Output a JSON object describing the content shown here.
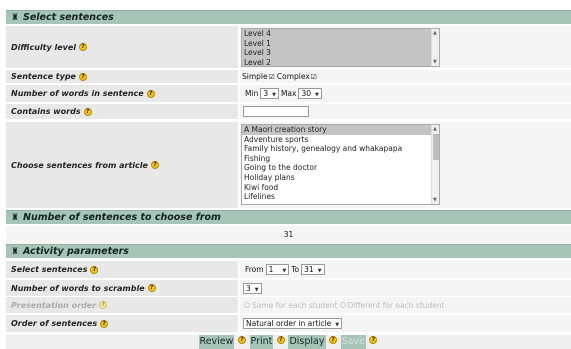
{
  "sections": {
    "select_sentences": "Select sentences",
    "count": "Number of sentences to choose from",
    "activity": "Activity parameters"
  },
  "difficulty": {
    "label": "Difficulty level",
    "options": [
      "Level 4",
      "Level 1",
      "Level 3",
      "Level 2"
    ]
  },
  "sentence_type": {
    "label": "Sentence type",
    "simple": "Simple",
    "complex": "Complex",
    "check_glyph": "☑"
  },
  "num_words": {
    "label": "Number of words in sentence",
    "min_label": "Min",
    "min_value": "3",
    "max_label": "Max",
    "max_value": "30"
  },
  "contains": {
    "label": "Contains words",
    "value": ""
  },
  "articles": {
    "label": "Choose sentences from article",
    "options": [
      "A Maori creation story",
      "Adventure sports",
      "Family history, genealogy and whakapapa",
      "Fishing",
      "Going to the doctor",
      "Holiday plans",
      "Kiwi food",
      "Lifelines"
    ]
  },
  "count_value": "31",
  "select_range": {
    "label": "Select sentences",
    "from_label": "From",
    "from_value": "1",
    "to_label": "To",
    "to_value": "31"
  },
  "scramble": {
    "label": "Number of words to scramble",
    "value": "3"
  },
  "presentation": {
    "label": "Presentation order",
    "same": "Same for each student",
    "different": "Different for each student"
  },
  "order": {
    "label": "Order of sentences",
    "value": "Natural order in article"
  },
  "buttons": {
    "review": "Review",
    "print": "Print",
    "display": "Display",
    "save": "Save"
  },
  "icons": {
    "help": "?",
    "section": "♜"
  },
  "colors": {
    "header_bg": "#a6c4b7",
    "label_bg": "#e8e8e8",
    "value_bg": "#f5f5f5",
    "help_yellow": "#f0c419"
  }
}
